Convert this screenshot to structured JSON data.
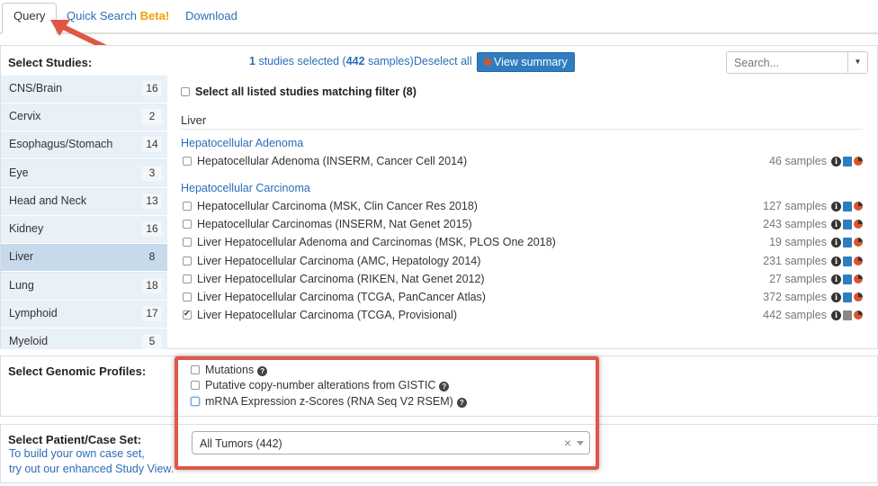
{
  "tabs": {
    "query": "Query",
    "quick_search": "Quick Search",
    "quick_search_badge": "Beta!",
    "download": "Download"
  },
  "studies_panel": {
    "title": "Select Studies:",
    "selected_count": "1",
    "selected_text_mid": "studies selected (",
    "selected_samples": "442",
    "selected_text_end": "samples)",
    "deselect_all": "Deselect all",
    "view_summary": "View summary",
    "search_placeholder": "Search...",
    "select_all_label": "Select all listed studies matching filter (8)"
  },
  "sidebar": {
    "items": [
      {
        "label": "CNS/Brain",
        "count": "16"
      },
      {
        "label": "Cervix",
        "count": "2"
      },
      {
        "label": "Esophagus/Stomach",
        "count": "14"
      },
      {
        "label": "Eye",
        "count": "3"
      },
      {
        "label": "Head and Neck",
        "count": "13"
      },
      {
        "label": "Kidney",
        "count": "16"
      },
      {
        "label": "Liver",
        "count": "8"
      },
      {
        "label": "Lung",
        "count": "18"
      },
      {
        "label": "Lymphoid",
        "count": "17"
      },
      {
        "label": "Myeloid",
        "count": "5"
      }
    ]
  },
  "study_list": {
    "group": "Liver",
    "subgroups": [
      {
        "title": "Hepatocellular Adenoma"
      },
      {
        "title": "Hepatocellular Carcinoma"
      }
    ],
    "studies": [
      {
        "name": "Hepatocellular Adenoma (INSERM, Cancer Cell 2014)",
        "samples": "46 samples",
        "checked": false
      },
      {
        "name": "Hepatocellular Carcinoma (MSK, Clin Cancer Res 2018)",
        "samples": "127 samples",
        "checked": false
      },
      {
        "name": "Hepatocellular Carcinomas (INSERM, Nat Genet 2015)",
        "samples": "243 samples",
        "checked": false
      },
      {
        "name": "Liver Hepatocellular Adenoma and Carcinomas (MSK, PLOS One 2018)",
        "samples": "19 samples",
        "checked": false
      },
      {
        "name": "Liver Hepatocellular Carcinoma (AMC, Hepatology 2014)",
        "samples": "231 samples",
        "checked": false
      },
      {
        "name": "Liver Hepatocellular Carcinoma (RIKEN, Nat Genet 2012)",
        "samples": "27 samples",
        "checked": false
      },
      {
        "name": "Liver Hepatocellular Carcinoma (TCGA, PanCancer Atlas)",
        "samples": "372 samples",
        "checked": false
      },
      {
        "name": "Liver Hepatocellular Carcinoma (TCGA, Provisional)",
        "samples": "442 samples",
        "checked": true
      }
    ]
  },
  "genomic_profiles": {
    "title": "Select Genomic Profiles:",
    "profiles": [
      {
        "label": "Mutations"
      },
      {
        "label": "Putative copy-number alterations from GISTIC"
      },
      {
        "label": "mRNA Expression z-Scores (RNA Seq V2 RSEM)"
      }
    ]
  },
  "case_set": {
    "title": "Select Patient/Case Set:",
    "link_line1": "To build your own case set,",
    "link_line2": "try out our enhanced Study View.",
    "selected": "All Tumors (442)"
  },
  "colors": {
    "link": "#2a6eb8",
    "button": "#2f7dbf",
    "highlight": "#e05747",
    "beta": "#f0a000"
  }
}
